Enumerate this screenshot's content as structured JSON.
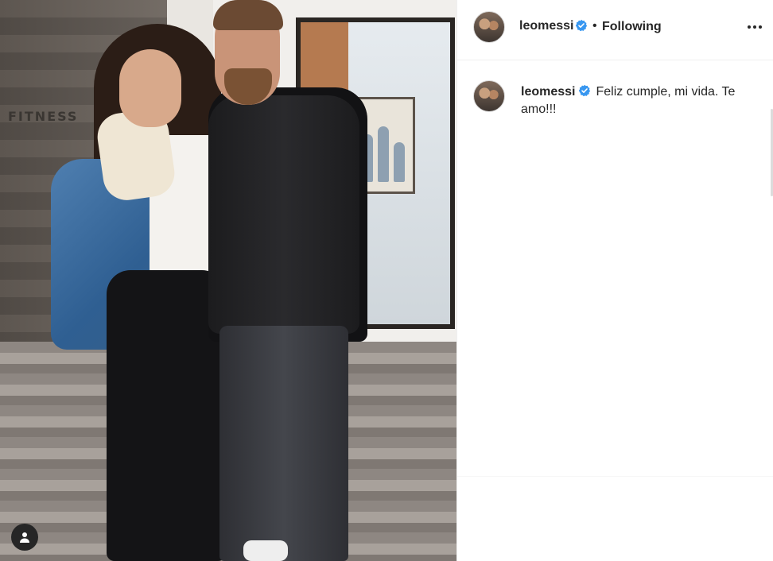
{
  "post": {
    "author": "leomessi",
    "follow_status": "Following",
    "separator": "•",
    "caption": "Feliz cumple, mi vida. Te amo!!!",
    "photo_sign_text": "FITNESS"
  },
  "icons": {
    "verified": "verified-badge-icon",
    "more": "more-options-icon",
    "tag": "user-tag-icon"
  },
  "colors": {
    "verified": "#3897f0",
    "text": "#262626",
    "divider": "#efefef"
  }
}
